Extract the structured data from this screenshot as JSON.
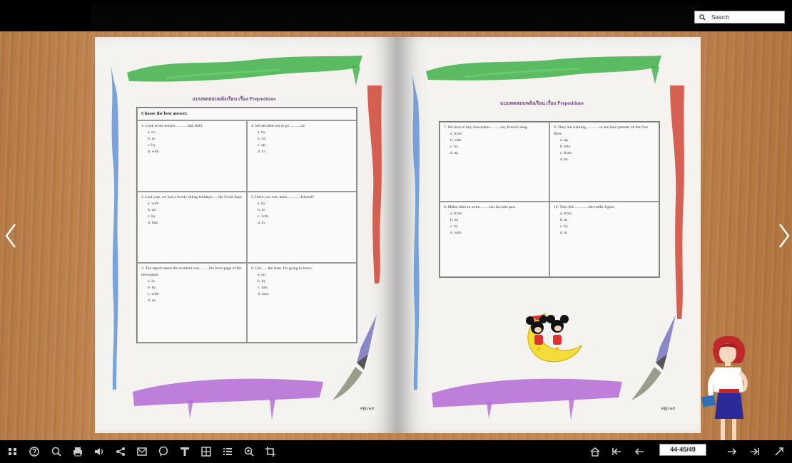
{
  "search": {
    "placeholder": "Search"
  },
  "book": {
    "left_page": {
      "title": "แบบทดสอบหลังเรียน เรื่อง Prepositions",
      "instruction": "Choose the best answer.",
      "questions": [
        {
          "q": "1. Look at the horses.............that field.",
          "opts": [
            "a.  on",
            "b.  in",
            "c.  by",
            "d.  with"
          ]
        },
        {
          "q": "4. We decided not to go ..........car.",
          "opts": [
            "a.  by",
            "b.  on",
            "c.  up",
            "d.  in"
          ]
        },
        {
          "q": "2. Last year, we had a lovely skiing holidays..... the Swiss Alps",
          "opts": [
            "a.  with",
            "b.  on",
            "c.  by",
            "d.  into"
          ]
        },
        {
          "q": "5. Have you ever been..............Ireland?",
          "opts": [
            "a.  by",
            "b.  to",
            "c.  with",
            "d.  in"
          ]
        },
        {
          "q": "3. The report about the accident was..........the front page of the newspaper.",
          "opts": [
            "a.  in",
            "b.  by",
            "c.  with",
            "d.  on"
          ]
        },
        {
          "q": "6. Get.......the train. It's going to leave.",
          "opts": [
            "a.  on",
            "b.  by",
            "c.  into",
            "d.  onto"
          ]
        }
      ],
      "code": "ดฐม/๑๕"
    },
    "right_page": {
      "title": "แบบทดสอบหลังเรียน เรื่อง Prepositions",
      "questions": [
        {
          "q": "7. We love to buy chocolates...........my friend's shop.",
          "opts": [
            "a.  from",
            "b.  with",
            "c.  by",
            "d.  up"
          ]
        },
        {
          "q": "9. They are walking..............to see their parents on the first floor.",
          "opts": [
            "a.  up",
            "b.  into",
            "c.  from",
            "d.  by"
          ]
        },
        {
          "q": "8. Malee likes to write..........her favorite pen.",
          "opts": [
            "a.  from",
            "b.  on",
            "c.  by",
            "d.  with"
          ]
        },
        {
          "q": "10.  Turn left...............the traffic lights.",
          "opts": [
            "a.  from",
            "b.  at",
            "c.  by",
            "d.  in"
          ]
        }
      ],
      "code": "ดฐม/๑๕"
    }
  },
  "pagination": {
    "current": "44-45/49"
  },
  "toolbar": {
    "left_icons": [
      "thumbnails-icon",
      "help-icon",
      "search-icon",
      "print-icon",
      "sound-icon",
      "share-icon",
      "email-icon",
      "comment-icon",
      "text-icon",
      "grid-icon",
      "list-icon",
      "zoom-in-icon",
      "crop-icon"
    ],
    "right_icons": [
      "home-icon",
      "first-page-icon",
      "prev-page-icon",
      "next-page-icon",
      "last-page-icon",
      "fullscreen-icon"
    ]
  },
  "colors": {
    "wood": "#c48a55",
    "paper": "#f5f3ef",
    "green_paint": "#3fb04a",
    "red_paint": "#d04535",
    "blue_paint": "#5a8fd8",
    "purple_paint": "#b36ad6"
  }
}
